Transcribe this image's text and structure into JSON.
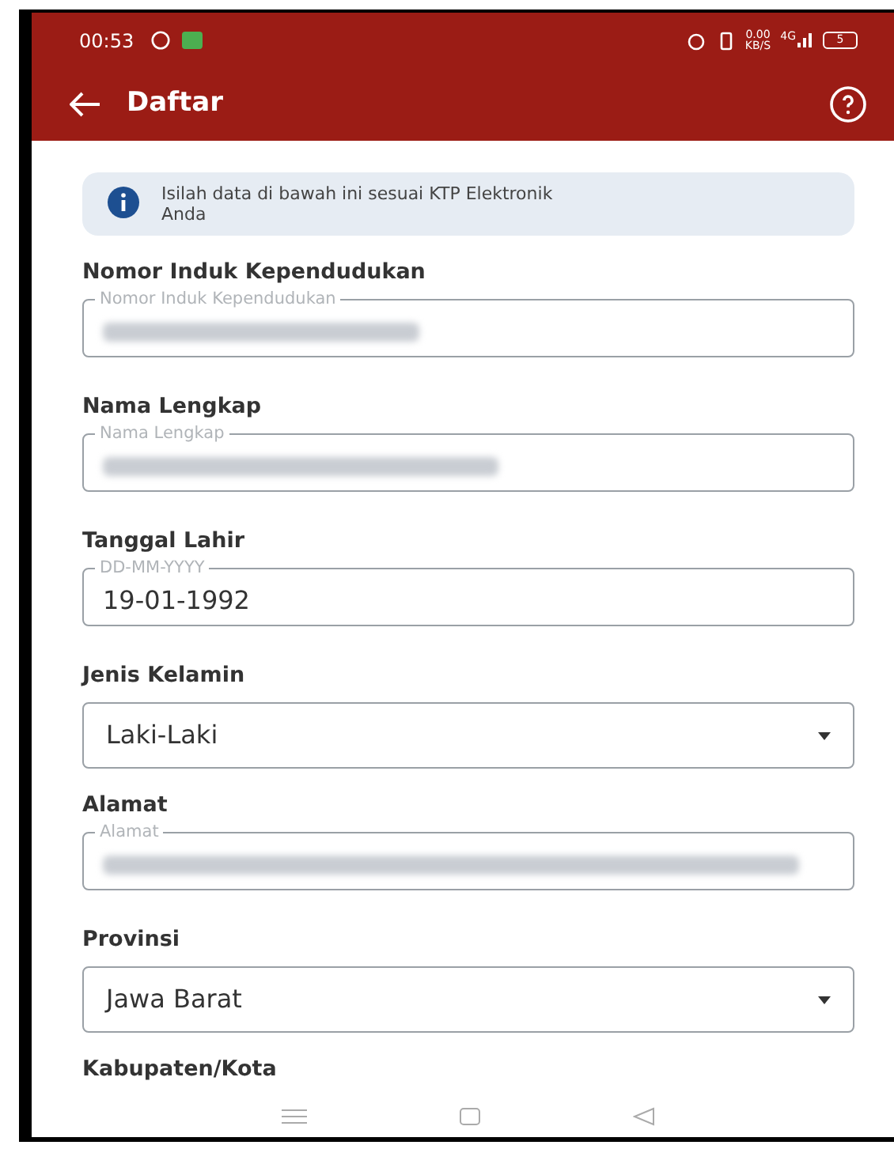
{
  "status_bar": {
    "time": "00:53",
    "speed": "0.00",
    "speed_unit": "KB/S",
    "network": "4G",
    "battery": "5"
  },
  "app_bar": {
    "title": "Daftar"
  },
  "notice": {
    "text": "Isilah data di bawah ini sesuai KTP Elektronik Anda"
  },
  "fields": [
    {
      "kind": "text",
      "label": "Nomor Induk Kependudukan",
      "placeholder": "Nomor Induk Kependudukan",
      "redacted": true
    },
    {
      "kind": "text",
      "label": "Nama Lengkap",
      "placeholder": "Nama Lengkap",
      "redacted": true
    },
    {
      "kind": "text",
      "label": "Tanggal Lahir",
      "placeholder": "DD-MM-YYYY",
      "value": "19-01-1992",
      "redacted": false
    },
    {
      "kind": "select",
      "label": "Jenis Kelamin",
      "value": "Laki-Laki"
    },
    {
      "kind": "text",
      "label": "Alamat",
      "placeholder": "Alamat",
      "redacted": true
    },
    {
      "kind": "select",
      "label": "Provinsi",
      "value": "Jawa Barat"
    },
    {
      "kind": "heading",
      "label": "Kabupaten/Kota"
    }
  ]
}
